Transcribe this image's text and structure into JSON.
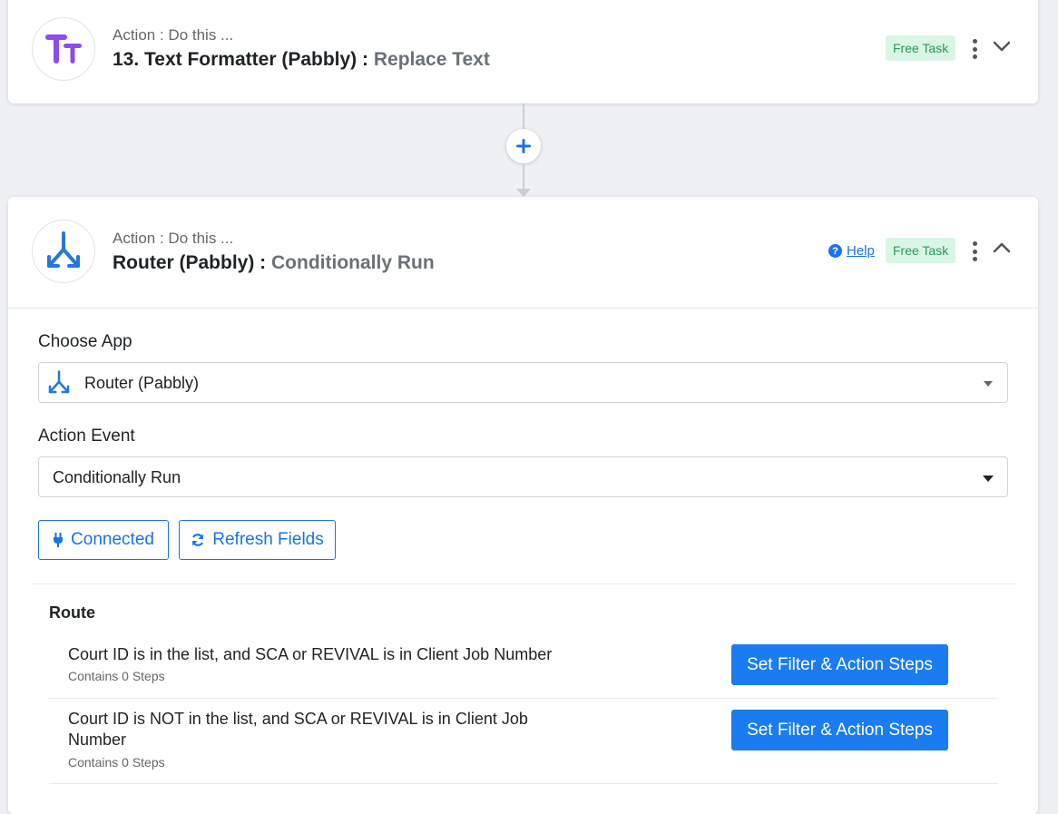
{
  "step13": {
    "action_label": "Action : Do this ...",
    "title": "13. Text Formatter (Pabbly) : ",
    "event": "Replace Text",
    "badge": "Free Task",
    "icon": "text-formatter-icon",
    "icon_color": "#8b4cf0"
  },
  "step14": {
    "action_label": "Action : Do this ...",
    "title": "Router (Pabbly) : ",
    "event": "Conditionally Run",
    "badge": "Free Task",
    "help_label": "Help",
    "icon": "router-icon",
    "icon_color": "#2677d8",
    "choose_app_label": "Choose App",
    "choose_app_value": "Router (Pabbly)",
    "action_event_label": "Action Event",
    "action_event_value": "Conditionally Run",
    "connected_label": "Connected",
    "refresh_label": "Refresh Fields",
    "route_title": "Route",
    "routes": [
      {
        "text": "Court ID is in the list, and SCA or REVIVAL is in Client Job Number",
        "sub": "Contains 0 Steps",
        "button": "Set Filter & Action Steps"
      },
      {
        "text": "Court ID is NOT in the list, and SCA or REVIVAL is in Client Job Number",
        "sub": "Contains 0 Steps",
        "button": "Set Filter & Action Steps"
      }
    ]
  },
  "colors": {
    "accent": "#1a73e8",
    "badge_bg": "#d9f6e4",
    "badge_text": "#2a9a55"
  }
}
